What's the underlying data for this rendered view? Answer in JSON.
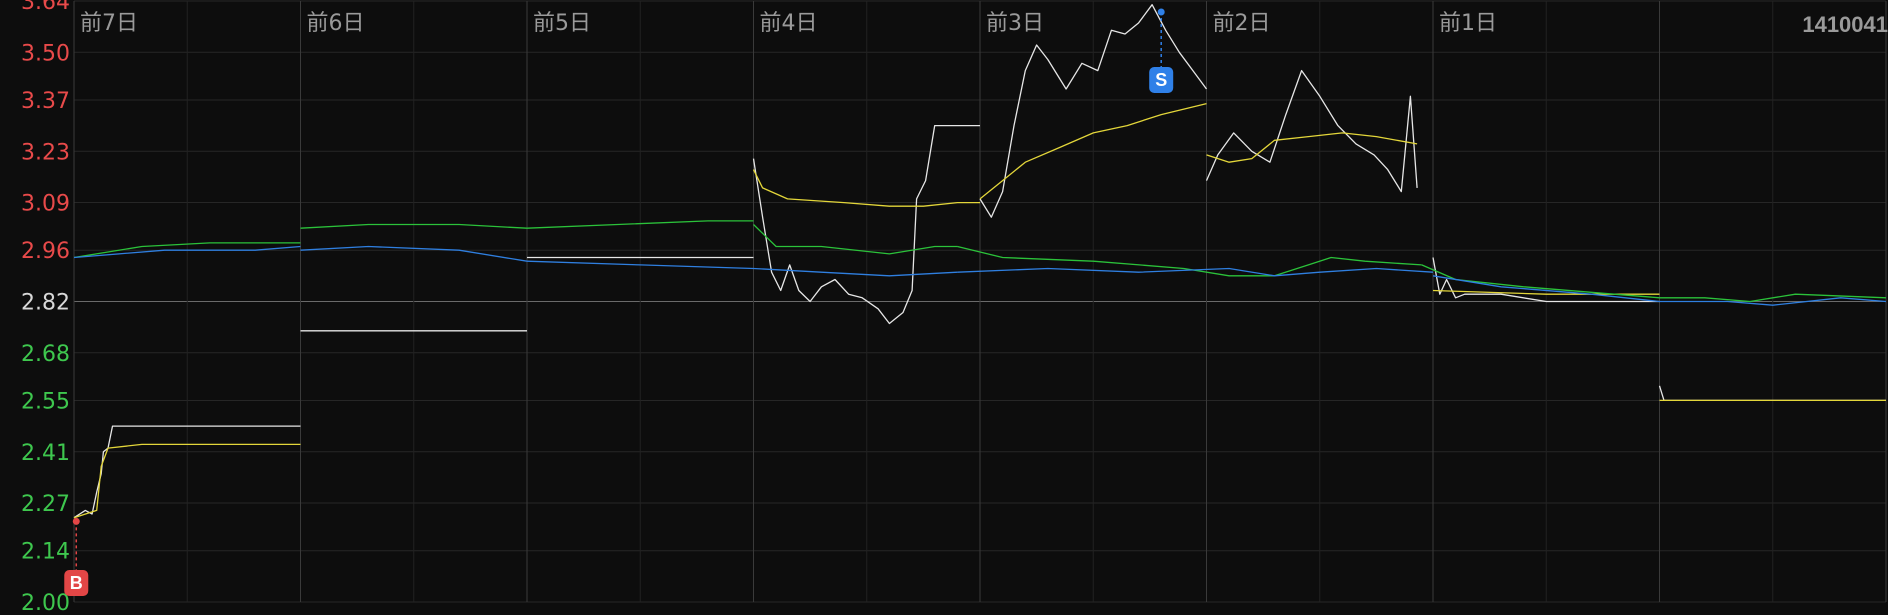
{
  "chart_data": {
    "type": "line",
    "title": "",
    "code_label": "1410041",
    "day_labels": [
      "前7日",
      "前6日",
      "前5日",
      "前4日",
      "前3日",
      "前2日",
      "前1日"
    ],
    "y_ticks": [
      "3.64",
      "3.50",
      "3.37",
      "3.23",
      "3.09",
      "2.96",
      "2.82",
      "2.68",
      "2.55",
      "2.41",
      "2.27",
      "2.14",
      "2.00"
    ],
    "ylim": [
      2.0,
      3.64
    ],
    "reference_price": 2.82,
    "x_range": [
      0,
      8
    ],
    "colors": {
      "up": "#e84a4a",
      "down": "#3ec74e",
      "ref": "#d8d8d8",
      "price": "#e6e6e6",
      "avg": "#e3d63a",
      "series_green": "#2bc23a",
      "series_blue": "#2f7fe0",
      "buy": "#e24646",
      "sell": "#2f80e8"
    },
    "markers": [
      {
        "label": "B",
        "x": 0.01,
        "y": 2.22,
        "kind": "buy"
      },
      {
        "label": "S",
        "x": 4.8,
        "y": 3.61,
        "kind": "sell"
      }
    ],
    "series": [
      {
        "id": "price",
        "color_key": "price",
        "segments": [
          [
            [
              0.0,
              2.23
            ],
            [
              0.05,
              2.25
            ],
            [
              0.08,
              2.24
            ],
            [
              0.1,
              2.3
            ],
            [
              0.12,
              2.35
            ],
            [
              0.13,
              2.41
            ],
            [
              0.15,
              2.42
            ],
            [
              0.17,
              2.48
            ],
            [
              0.2,
              2.48
            ],
            [
              1.0,
              2.48
            ]
          ],
          [
            [
              1.0,
              2.74
            ],
            [
              2.0,
              2.74
            ]
          ],
          [
            [
              2.0,
              2.94
            ],
            [
              3.0,
              2.94
            ]
          ],
          [
            [
              3.0,
              3.21
            ],
            [
              3.04,
              3.05
            ],
            [
              3.08,
              2.9
            ],
            [
              3.12,
              2.85
            ],
            [
              3.16,
              2.92
            ],
            [
              3.2,
              2.85
            ],
            [
              3.25,
              2.82
            ],
            [
              3.3,
              2.86
            ],
            [
              3.36,
              2.88
            ],
            [
              3.42,
              2.84
            ],
            [
              3.48,
              2.83
            ],
            [
              3.55,
              2.8
            ],
            [
              3.6,
              2.76
            ],
            [
              3.66,
              2.79
            ],
            [
              3.7,
              2.85
            ],
            [
              3.72,
              3.1
            ],
            [
              3.76,
              3.15
            ],
            [
              3.8,
              3.3
            ],
            [
              4.0,
              3.3
            ]
          ],
          [
            [
              4.0,
              3.1
            ],
            [
              4.05,
              3.05
            ],
            [
              4.1,
              3.12
            ],
            [
              4.15,
              3.3
            ],
            [
              4.2,
              3.45
            ],
            [
              4.25,
              3.52
            ],
            [
              4.3,
              3.48
            ],
            [
              4.38,
              3.4
            ],
            [
              4.45,
              3.47
            ],
            [
              4.52,
              3.45
            ],
            [
              4.58,
              3.56
            ],
            [
              4.64,
              3.55
            ],
            [
              4.7,
              3.58
            ],
            [
              4.76,
              3.63
            ],
            [
              4.82,
              3.56
            ],
            [
              4.88,
              3.5
            ],
            [
              4.94,
              3.45
            ],
            [
              5.0,
              3.4
            ]
          ],
          [
            [
              5.0,
              3.15
            ],
            [
              5.05,
              3.22
            ],
            [
              5.12,
              3.28
            ],
            [
              5.2,
              3.23
            ],
            [
              5.28,
              3.2
            ],
            [
              5.35,
              3.33
            ],
            [
              5.42,
              3.45
            ],
            [
              5.5,
              3.38
            ],
            [
              5.58,
              3.3
            ],
            [
              5.66,
              3.25
            ],
            [
              5.74,
              3.22
            ],
            [
              5.8,
              3.18
            ],
            [
              5.86,
              3.12
            ],
            [
              5.9,
              3.38
            ],
            [
              5.93,
              3.13
            ]
          ],
          [
            [
              6.0,
              2.94
            ],
            [
              6.03,
              2.84
            ],
            [
              6.06,
              2.88
            ],
            [
              6.1,
              2.83
            ],
            [
              6.14,
              2.84
            ],
            [
              6.3,
              2.84
            ],
            [
              6.5,
              2.82
            ],
            [
              7.0,
              2.82
            ]
          ],
          [
            [
              7.0,
              2.59
            ],
            [
              7.02,
              2.55
            ],
            [
              7.2,
              2.55
            ],
            [
              8.0,
              2.55
            ]
          ]
        ]
      },
      {
        "id": "avg",
        "color_key": "avg",
        "segments": [
          [
            [
              0.0,
              2.23
            ],
            [
              0.1,
              2.25
            ],
            [
              0.12,
              2.37
            ],
            [
              0.15,
              2.42
            ],
            [
              0.3,
              2.43
            ],
            [
              1.0,
              2.43
            ]
          ],
          [
            [
              3.0,
              3.18
            ],
            [
              3.04,
              3.13
            ],
            [
              3.15,
              3.1
            ],
            [
              3.4,
              3.09
            ],
            [
              3.6,
              3.08
            ],
            [
              3.75,
              3.08
            ],
            [
              3.9,
              3.09
            ],
            [
              4.0,
              3.09
            ]
          ],
          [
            [
              4.0,
              3.1
            ],
            [
              4.1,
              3.15
            ],
            [
              4.2,
              3.2
            ],
            [
              4.35,
              3.24
            ],
            [
              4.5,
              3.28
            ],
            [
              4.65,
              3.3
            ],
            [
              4.8,
              3.33
            ],
            [
              5.0,
              3.36
            ]
          ],
          [
            [
              5.0,
              3.22
            ],
            [
              5.1,
              3.2
            ],
            [
              5.2,
              3.21
            ],
            [
              5.3,
              3.26
            ],
            [
              5.45,
              3.27
            ],
            [
              5.6,
              3.28
            ],
            [
              5.75,
              3.27
            ],
            [
              5.93,
              3.25
            ]
          ],
          [
            [
              6.0,
              2.85
            ],
            [
              6.5,
              2.84
            ],
            [
              7.0,
              2.84
            ]
          ],
          [
            [
              7.0,
              2.55
            ],
            [
              8.0,
              2.55
            ]
          ]
        ]
      },
      {
        "id": "green",
        "color_key": "series_green",
        "segments": [
          [
            [
              0.0,
              2.94
            ],
            [
              0.3,
              2.97
            ],
            [
              0.6,
              2.98
            ],
            [
              1.0,
              2.98
            ]
          ],
          [
            [
              1.0,
              3.02
            ],
            [
              1.3,
              3.03
            ],
            [
              1.7,
              3.03
            ],
            [
              2.0,
              3.02
            ]
          ],
          [
            [
              2.0,
              3.02
            ],
            [
              2.4,
              3.03
            ],
            [
              2.8,
              3.04
            ],
            [
              3.0,
              3.04
            ]
          ],
          [
            [
              3.0,
              3.03
            ],
            [
              3.1,
              2.97
            ],
            [
              3.3,
              2.97
            ],
            [
              3.6,
              2.95
            ],
            [
              3.8,
              2.97
            ],
            [
              3.9,
              2.97
            ]
          ],
          [
            [
              3.9,
              2.97
            ],
            [
              4.1,
              2.94
            ],
            [
              4.5,
              2.93
            ],
            [
              4.9,
              2.91
            ],
            [
              5.1,
              2.89
            ],
            [
              5.3,
              2.89
            ],
            [
              5.45,
              2.92
            ],
            [
              5.55,
              2.94
            ],
            [
              5.7,
              2.93
            ],
            [
              5.95,
              2.92
            ]
          ],
          [
            [
              5.95,
              2.92
            ],
            [
              6.1,
              2.88
            ],
            [
              6.4,
              2.86
            ],
            [
              6.8,
              2.84
            ],
            [
              7.0,
              2.83
            ],
            [
              7.2,
              2.83
            ],
            [
              7.4,
              2.82
            ],
            [
              7.6,
              2.84
            ],
            [
              8.0,
              2.83
            ]
          ]
        ]
      },
      {
        "id": "blue",
        "color_key": "series_blue",
        "segments": [
          [
            [
              0.0,
              2.94
            ],
            [
              0.4,
              2.96
            ],
            [
              0.8,
              2.96
            ],
            [
              1.0,
              2.97
            ]
          ],
          [
            [
              1.0,
              2.96
            ],
            [
              1.3,
              2.97
            ],
            [
              1.7,
              2.96
            ],
            [
              2.0,
              2.93
            ]
          ],
          [
            [
              2.0,
              2.93
            ],
            [
              2.5,
              2.92
            ],
            [
              3.0,
              2.91
            ]
          ],
          [
            [
              3.0,
              2.91
            ],
            [
              3.3,
              2.9
            ],
            [
              3.6,
              2.89
            ],
            [
              3.9,
              2.9
            ]
          ],
          [
            [
              3.9,
              2.9
            ],
            [
              4.3,
              2.91
            ],
            [
              4.7,
              2.9
            ],
            [
              5.1,
              2.91
            ],
            [
              5.3,
              2.89
            ],
            [
              5.5,
              2.9
            ],
            [
              5.75,
              2.91
            ],
            [
              6.0,
              2.9
            ]
          ],
          [
            [
              6.0,
              2.89
            ],
            [
              6.3,
              2.86
            ],
            [
              6.7,
              2.84
            ],
            [
              7.0,
              2.82
            ],
            [
              7.3,
              2.82
            ],
            [
              7.5,
              2.81
            ],
            [
              7.8,
              2.83
            ],
            [
              8.0,
              2.82
            ]
          ]
        ]
      }
    ]
  }
}
